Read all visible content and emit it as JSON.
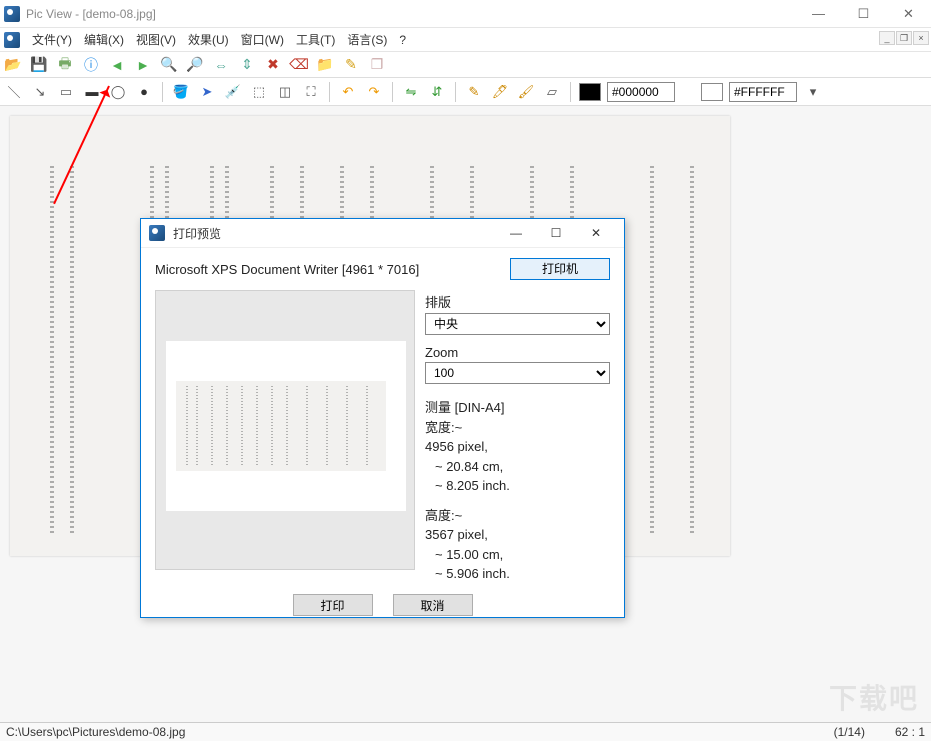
{
  "window": {
    "title": "Pic View - [demo-08.jpg]"
  },
  "menu": {
    "file": "文件(Y)",
    "edit": "编辑(X)",
    "view": "视图(V)",
    "effect": "效果(U)",
    "window": "窗口(W)",
    "tools": "工具(T)",
    "language": "语言(S)",
    "help": "?"
  },
  "toolbar2": {
    "color1_hex": "#000000",
    "color2_hex": "#FFFFFF"
  },
  "dialog": {
    "title": "打印预览",
    "printer_info": "Microsoft XPS Document Writer [4961 * 7016]",
    "printer_btn": "打印机",
    "layout_label": "排版",
    "layout_value": "中央",
    "zoom_label": "Zoom",
    "zoom_value": "100",
    "measure_label": "测量 [DIN-A4]",
    "width_label": "宽度:~",
    "width_px": "4956 pixel,",
    "width_cm": " ~ 20.84 cm,",
    "width_in": " ~ 8.205 inch.",
    "height_label": "高度:~",
    "height_px": "3567 pixel,",
    "height_cm": " ~ 15.00 cm,",
    "height_in": " ~ 5.906 inch.",
    "print_btn": "打印",
    "cancel_btn": "取消"
  },
  "status": {
    "path": "C:\\Users\\pc\\Pictures\\demo-08.jpg",
    "index": "(1/14)",
    "zoom": "62 : 1"
  },
  "watermark": "下载吧"
}
